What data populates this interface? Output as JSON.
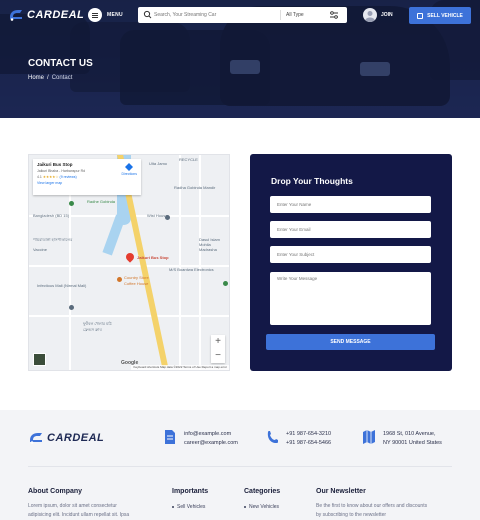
{
  "brand": {
    "name": "CARDEAL",
    "accent": "#3d72d9",
    "navy": "#131847"
  },
  "header": {
    "menu_label": "MENU",
    "search_placeholder": "Search, Your Streaming Car",
    "type_select": "All Type",
    "join_label": "JOIN",
    "sell_label": "SELL VEHICLE"
  },
  "hero": {
    "title": "CONTACT US",
    "breadcrumb": {
      "home": "Home",
      "separator": "/",
      "current": "Contact"
    }
  },
  "map": {
    "place_name": "Jaikuri Bus Stop",
    "address": "Jaikuri Bhaba - Harbanspur Rd",
    "rating": "4.1",
    "stars": "★★★★☆",
    "reviews": "(9 reviews)",
    "larger_map": "View larger map",
    "directions": "Directions",
    "labels": {
      "recycle": "RECYCLE",
      "ulta": "Ulta Jamo",
      "radha": "Radha Gobinda Mandir",
      "radhe": "Radhe Gobinda",
      "bangladesh": "Bangladesh (BD 15)",
      "bengali1": "পায়রাডাঙ্গা হাসপাতালের",
      "vaccine": "Vaccine",
      "wisthouse": "Wist House",
      "bus_stop": "Jaikuri Bus Stop",
      "country_store": "Country Store",
      "coffee": "Coffee House",
      "dasul": "Dasul Islam Mohila Madrasha",
      "mr_ind": "M/S Boardwa Electronics",
      "infectious": "Infectious Mali (Nirmal Mali)",
      "bengali2": "ফুটবল খেলার মাঠ",
      "bengali3": "ফ্রেন্ডস ক্লাব",
      "google": "Google",
      "attribution": "Keyboard shortcuts   Map data ©2022   Terms of Use   Report a map error"
    }
  },
  "form": {
    "title": "Drop Your Thoughts",
    "name_placeholder": "Enter Your Name",
    "email_placeholder": "Enter Your Email",
    "subject_placeholder": "Enter Your Subject",
    "message_placeholder": "Write Your Message",
    "submit_label": "SEND MESSAGE"
  },
  "footer": {
    "logo": "CARDEAL",
    "email1": "info@example.com",
    "email2": "career@example.com",
    "phone1": "+91 987-654-3210",
    "phone2": "+91 987-654-5466",
    "address1": "1968 St, 010 Avenue,",
    "address2": "NY 90001 United States",
    "about_title": "About Company",
    "about_text1": "Lorem ipsum, dolor sit amet consectetur",
    "about_text2": "adipisicing elit. Incidunt ullam repellat sit. Ipsa",
    "importants_title": "Importants",
    "importants_item": "Sell Vehicles",
    "categories_title": "Categories",
    "categories_item": "New Vehicles",
    "newsletter_title": "Our Newsletter",
    "newsletter_text1": "Be the first to know about our offers and discounts",
    "newsletter_text2": "by subscribing to the newsletter"
  }
}
